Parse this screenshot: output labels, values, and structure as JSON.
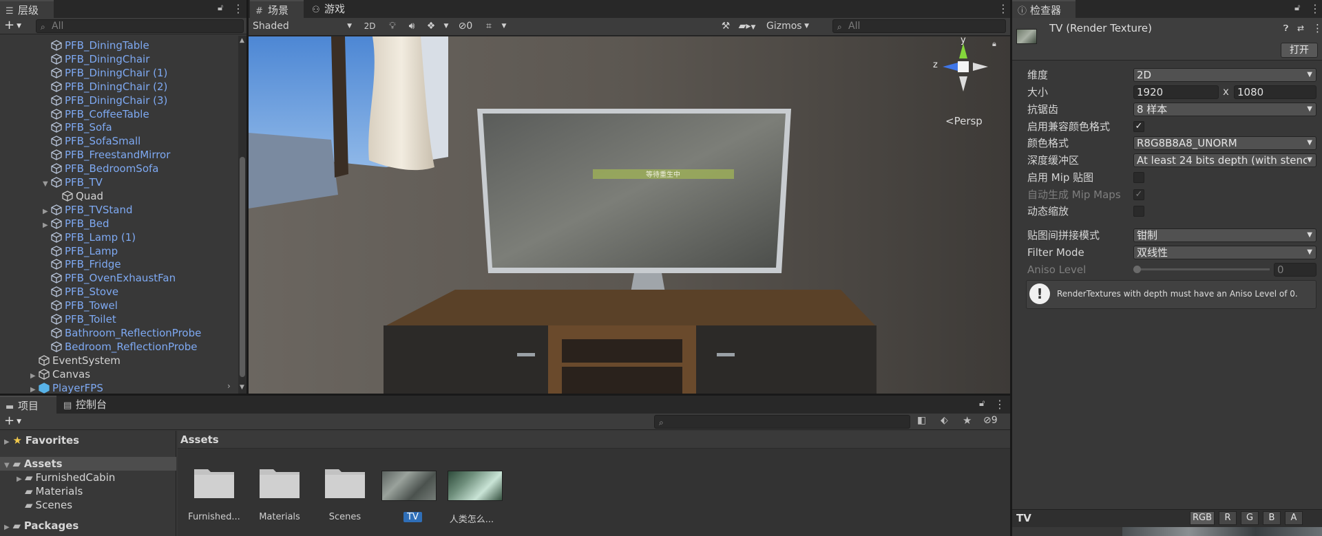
{
  "hierarchy": {
    "tab_label": "层级",
    "search_placeholder": "All",
    "items": [
      {
        "label": "PFB_DiningTable",
        "kind": "prefab",
        "indent": 3,
        "arrow": ""
      },
      {
        "label": "PFB_DiningChair",
        "kind": "prefab",
        "indent": 3,
        "arrow": ""
      },
      {
        "label": "PFB_DiningChair (1)",
        "kind": "prefab",
        "indent": 3,
        "arrow": ""
      },
      {
        "label": "PFB_DiningChair (2)",
        "kind": "prefab",
        "indent": 3,
        "arrow": ""
      },
      {
        "label": "PFB_DiningChair (3)",
        "kind": "prefab",
        "indent": 3,
        "arrow": ""
      },
      {
        "label": "PFB_CoffeeTable",
        "kind": "prefab",
        "indent": 3,
        "arrow": ""
      },
      {
        "label": "PFB_Sofa",
        "kind": "prefab",
        "indent": 3,
        "arrow": ""
      },
      {
        "label": "PFB_SofaSmall",
        "kind": "prefab",
        "indent": 3,
        "arrow": ""
      },
      {
        "label": "PFB_FreestandMirror",
        "kind": "prefab",
        "indent": 3,
        "arrow": ""
      },
      {
        "label": "PFB_BedroomSofa",
        "kind": "prefab",
        "indent": 3,
        "arrow": ""
      },
      {
        "label": "PFB_TV",
        "kind": "prefab",
        "indent": 3,
        "arrow": "▼"
      },
      {
        "label": "Quad",
        "kind": "plain",
        "indent": 4,
        "arrow": ""
      },
      {
        "label": "PFB_TVStand",
        "kind": "prefab",
        "indent": 3,
        "arrow": "▶"
      },
      {
        "label": "PFB_Bed",
        "kind": "prefab",
        "indent": 3,
        "arrow": "▶"
      },
      {
        "label": "PFB_Lamp (1)",
        "kind": "prefab",
        "indent": 3,
        "arrow": ""
      },
      {
        "label": "PFB_Lamp",
        "kind": "prefab",
        "indent": 3,
        "arrow": ""
      },
      {
        "label": "PFB_Fridge",
        "kind": "prefab",
        "indent": 3,
        "arrow": ""
      },
      {
        "label": "PFB_OvenExhaustFan",
        "kind": "prefab",
        "indent": 3,
        "arrow": ""
      },
      {
        "label": "PFB_Stove",
        "kind": "prefab",
        "indent": 3,
        "arrow": ""
      },
      {
        "label": "PFB_Towel",
        "kind": "prefab",
        "indent": 3,
        "arrow": ""
      },
      {
        "label": "PFB_Toilet",
        "kind": "prefab",
        "indent": 3,
        "arrow": ""
      },
      {
        "label": "Bathroom_ReflectionProbe",
        "kind": "prefab",
        "indent": 3,
        "arrow": ""
      },
      {
        "label": "Bedroom_ReflectionProbe",
        "kind": "prefab",
        "indent": 3,
        "arrow": ""
      },
      {
        "label": "EventSystem",
        "kind": "plain",
        "indent": 2,
        "arrow": ""
      },
      {
        "label": "Canvas",
        "kind": "plain",
        "indent": 2,
        "arrow": "▶"
      },
      {
        "label": "PlayerFPS",
        "kind": "prefab-root",
        "indent": 2,
        "arrow": "▶"
      }
    ]
  },
  "scene": {
    "tab_scene": "场景",
    "tab_game": "游戏",
    "shading_mode": "Shaded",
    "btn_2d": "2D",
    "hidden_count": "0",
    "gizmos_label": "Gizmos",
    "search_placeholder": "All",
    "persp_label": "Persp",
    "axis_y": "y",
    "axis_z": "z",
    "tv_banner": "等待重生中"
  },
  "inspector": {
    "tab_label": "检查器",
    "asset_title": "TV (Render Texture)",
    "open_button": "打开",
    "rows": {
      "dimension": {
        "label": "维度",
        "value": "2D"
      },
      "size": {
        "label": "大小",
        "width": "1920",
        "x": "x",
        "height": "1080"
      },
      "antialias": {
        "label": "抗锯齿",
        "value": "8 样本"
      },
      "compat_format": {
        "label": "启用兼容颜色格式",
        "checked": "✓"
      },
      "color_format": {
        "label": "颜色格式",
        "value": "R8G8B8A8_UNORM"
      },
      "depth_buffer": {
        "label": "深度缓冲区",
        "value": "At least 24 bits depth (with stenci"
      },
      "mip_maps": {
        "label": "启用 Mip 贴图",
        "checked": ""
      },
      "auto_mip": {
        "label": "自动生成 Mip Maps",
        "checked": "✓"
      },
      "dynamic_scale": {
        "label": "动态缩放",
        "checked": ""
      },
      "wrap_mode": {
        "label": "贴图间拼接模式",
        "value": "钳制"
      },
      "filter_mode": {
        "label": "Filter Mode",
        "value": "双线性"
      },
      "aniso_level": {
        "label": "Aniso Level",
        "value": "0"
      }
    },
    "warning_text": "RenderTextures with depth must have an Aniso Level of 0.",
    "preview": {
      "title": "TV",
      "channels": [
        "RGB",
        "R",
        "G",
        "B",
        "A"
      ]
    }
  },
  "project": {
    "tab_project": "项目",
    "tab_console": "控制台",
    "hidden_count": "9",
    "favorites_label": "Favorites",
    "assets_label": "Assets",
    "tree": [
      {
        "label": "FurnishedCabin",
        "indent": 1,
        "arrow": "▶"
      },
      {
        "label": "Materials",
        "indent": 1,
        "arrow": ""
      },
      {
        "label": "Scenes",
        "indent": 1,
        "arrow": ""
      }
    ],
    "packages_label": "Packages",
    "breadcrumb": "Assets",
    "assets": [
      {
        "label": "Furnished...",
        "type": "folder"
      },
      {
        "label": "Materials",
        "type": "folder"
      },
      {
        "label": "Scenes",
        "type": "folder"
      },
      {
        "label": "TV",
        "type": "texture"
      },
      {
        "label": "人类怎么...",
        "type": "image"
      }
    ]
  }
}
